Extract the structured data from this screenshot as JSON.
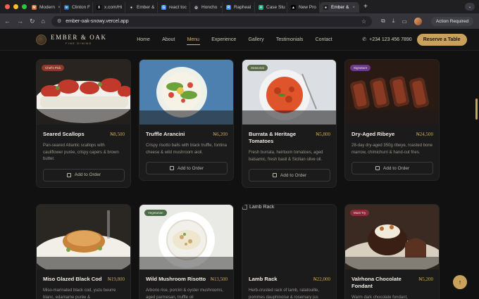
{
  "browser": {
    "tabs": [
      {
        "label": "Modern",
        "fav": "#e25b2f",
        "glyph": "M"
      },
      {
        "label": "Clinton F",
        "fav": "#0a66c2",
        "glyph": "in"
      },
      {
        "label": "x.com/Hi",
        "fav": "#000000",
        "glyph": "X"
      },
      {
        "label": "Ember &",
        "fav": "#222222",
        "glyph": "●"
      },
      {
        "label": "react toc",
        "fav": "#4285f4",
        "glyph": "G"
      },
      {
        "label": "Honcho",
        "fav": "#24292e",
        "glyph": "◎"
      },
      {
        "label": "Rapheal",
        "fav": "#3b82f6",
        "glyph": "R"
      },
      {
        "label": "Case Stu",
        "fav": "#10b981",
        "glyph": "✦"
      },
      {
        "label": "New Pro",
        "fav": "#000000",
        "glyph": "▲"
      },
      {
        "label": "Ember &",
        "fav": "#222222",
        "glyph": "●",
        "active": true
      }
    ],
    "url": "ember-oak-snowy.vercel.app",
    "action_required": "Action Required"
  },
  "site": {
    "logo_title": "EMBER & OAK",
    "logo_sub": "FINE DINING",
    "nav": [
      "Home",
      "About",
      "Menu",
      "Experience",
      "Gallery",
      "Testimonials",
      "Contact"
    ],
    "active_nav": "Menu",
    "phone": "+234 123 456 7890",
    "reserve_label": "Reserve a Table",
    "accent": "#c9a15d"
  },
  "menu": {
    "add_label": "Add to Order",
    "items": [
      {
        "name": "Seared Scallops",
        "price": "₦8,500",
        "badge": "Chef's Pick",
        "badge_color": "#8a3b2b",
        "desc": "Pan-seared Atlantic scallops with cauliflower purée, crispy capers & brown butter."
      },
      {
        "name": "Truffle Arancini",
        "price": "₦6,200",
        "badge": "",
        "badge_color": "",
        "desc": "Crispy risotto balls with black truffle, fontina cheese & wild mushroom aioli."
      },
      {
        "name": "Burrata & Heritage Tomatoes",
        "price": "₦5,800",
        "badge": "Seasonal",
        "badge_color": "#5b6b4a",
        "desc": "Fresh burrata, heirloom tomatoes, aged balsamic, fresh basil & Sicilian olive oil."
      },
      {
        "name": "Dry-Aged Ribeye",
        "price": "₦24,500",
        "badge": "Signature",
        "badge_color": "#6b3a8a",
        "desc": "28-day dry-aged 350g ribeye, roasted bone marrow, chimichurri & hand-cut fries."
      },
      {
        "name": "Miso Glazed Black Cod",
        "price": "₦19,800",
        "badge": "",
        "badge_color": "",
        "desc": "Miso-marinated black cod, yuzu beurre blanc, edamame purée &"
      },
      {
        "name": "Wild Mushroom Risotto",
        "price": "₦13,500",
        "badge": "Vegetarian",
        "badge_color": "#4a6b4a",
        "desc": "Arborio rice, porcini & oyster mushrooms, aged parmesan, truffle oil"
      },
      {
        "name": "Lamb Rack",
        "price": "₦22,000",
        "badge": "",
        "badge_color": "",
        "desc": "Herb-crusted rack of lamb, ratatouille, pommes dauphinoise & rosemary jus",
        "broken_img": "Lamb Rack"
      },
      {
        "name": "Valrhona Chocolate Fondant",
        "price": "₦5,200",
        "badge": "Must Try",
        "badge_color": "#8a2b3b",
        "desc": "Warm dark chocolate fondant,"
      }
    ]
  }
}
